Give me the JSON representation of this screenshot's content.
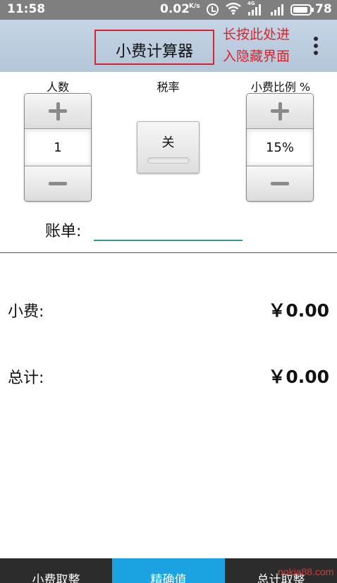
{
  "status_bar": {
    "time": "11:58",
    "net_speed": "0.02",
    "net_speed_unit": "K/s",
    "network_type": "4G",
    "battery": "78",
    "icons": [
      "alarm-icon",
      "wifi-icon",
      "cell-signal-icon",
      "cell-signal-icon",
      "battery-icon"
    ]
  },
  "header": {
    "title": "小费计算器",
    "annotation_line1": "长按此处进",
    "annotation_line2": "入隐藏界面",
    "annotation_color": "#d8242c",
    "menu_icon": "overflow-menu-icon"
  },
  "controls": {
    "people": {
      "label": "人数",
      "value": "1"
    },
    "tax": {
      "label": "税率",
      "toggle_label": "关"
    },
    "tip_rate": {
      "label": "小费比例 %",
      "value": "15%"
    }
  },
  "bill": {
    "label": "账单:",
    "value": "",
    "underline_color": "#2a9d9a"
  },
  "results": {
    "tip": {
      "label": "小费:",
      "value": "￥0.00"
    },
    "total": {
      "label": "总计:",
      "value": "￥0.00"
    }
  },
  "bottom_tabs": [
    {
      "label": "小费取整"
    },
    {
      "label": "精确值",
      "selected": true,
      "color": "#1aa3e0"
    },
    {
      "label": "总计取整"
    }
  ],
  "watermark": "nokia88.com"
}
